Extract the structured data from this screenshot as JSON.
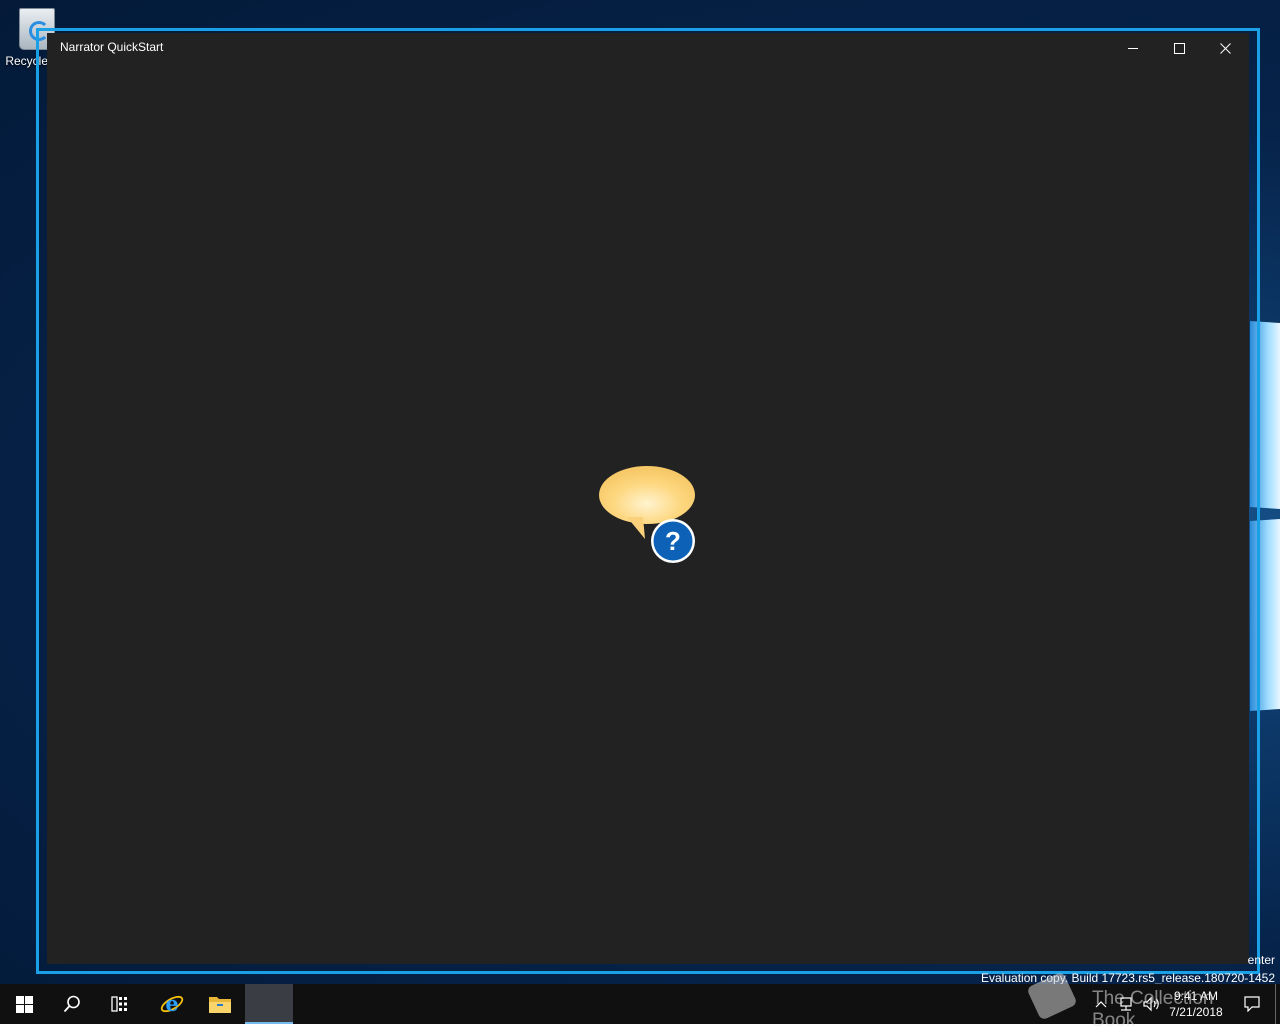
{
  "desktop": {
    "recycle_bin_label": "Recycle Bin"
  },
  "window": {
    "title": "Narrator QuickStart",
    "minimize_label": "Minimize",
    "maximize_label": "Maximize",
    "close_label": "Close",
    "content_icon": "narrator-speech-bubble-help-icon"
  },
  "watermark": {
    "line1": "enter",
    "line2": "Evaluation copy. Build 17723.rs5_release.180720-1452"
  },
  "overlay": {
    "collection_book": "The Collection Book"
  },
  "taskbar": {
    "start_icon": "windows-start-icon",
    "search_icon": "search-icon",
    "taskview_icon": "task-view-icon",
    "ie_icon": "internet-explorer-icon",
    "explorer_icon": "file-explorer-icon",
    "narrator_app_icon": "narrator-app-icon",
    "clock_time": "9:41 AM",
    "clock_date": "7/21/2018"
  },
  "colors": {
    "accent": "#1aa0e6",
    "window_bg": "#222222",
    "taskbar_bg": "#101010",
    "bubble": "#fdd77f",
    "help_badge": "#0d62b8"
  }
}
